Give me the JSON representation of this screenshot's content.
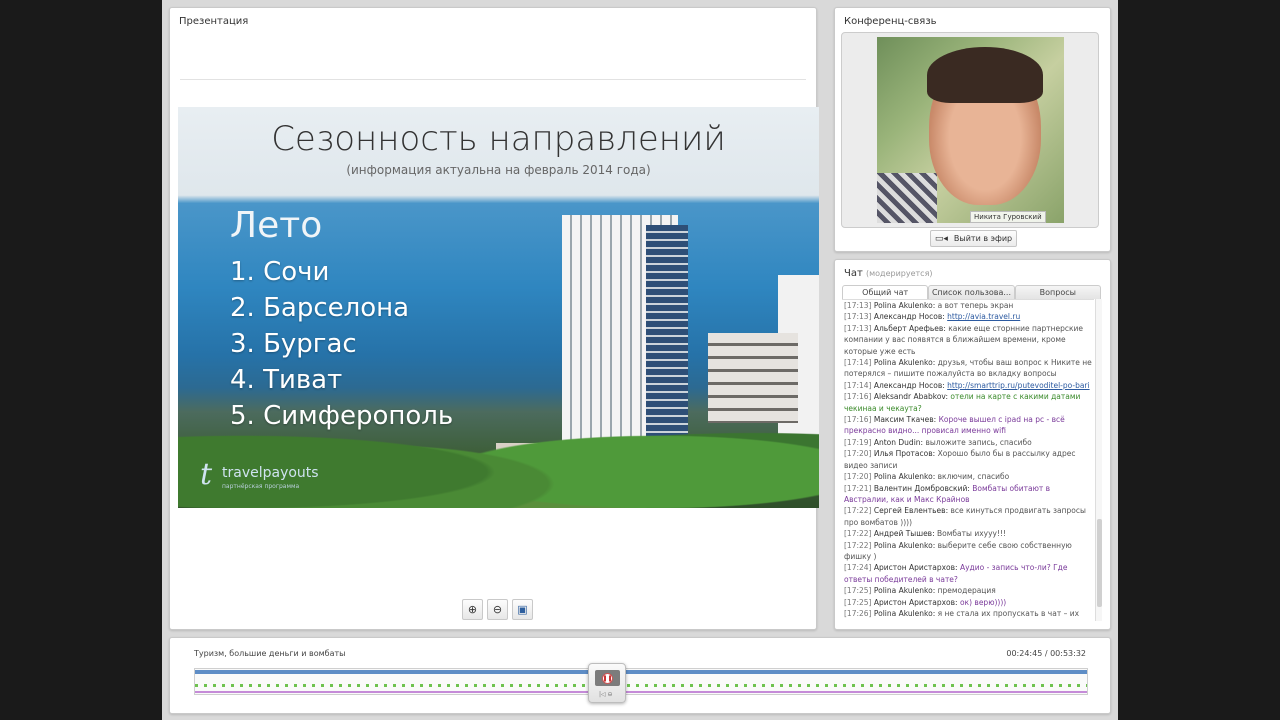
{
  "presentation": {
    "title": "Презентация",
    "slide": {
      "title": "Сезонность направлений",
      "subtitle": "(информация актуальна на февраль 2014 года)",
      "season": "Лето",
      "destinations": [
        "1. Сочи",
        "2. Барселона",
        "3. Бургас",
        "4. Тиват",
        "5. Симферополь"
      ],
      "logo_text": "travelpayouts",
      "logo_tagline": "партнёрская программа"
    },
    "toolbar": {
      "zoom_in_icon": "zoom-in-icon",
      "zoom_out_icon": "zoom-out-icon",
      "save_icon": "save-icon"
    }
  },
  "conference": {
    "title": "Конференц-связь",
    "speaker_name": "Никита Гуровский",
    "leave_button": "Выйти в эфир"
  },
  "chat": {
    "title": "Чат",
    "moderated": "(модерируется)",
    "tabs": [
      "Общий чат",
      "Список пользова...",
      "Вопросы"
    ],
    "messages": [
      {
        "time": "[17:13]",
        "author": "Polina Akulenko:",
        "text": "а вот теперь экран",
        "color": "gray"
      },
      {
        "time": "[17:13]",
        "author": "Александр Носов:",
        "text": "http://avia.travel.ru",
        "color": "link"
      },
      {
        "time": "[17:13]",
        "author": "Альберт Арефьев:",
        "text": "какие еще сторнние партнерские компании у вас появятся в ближайшем времени, кроме которые уже есть",
        "color": "gray"
      },
      {
        "time": "[17:14]",
        "author": "Polina Akulenko:",
        "text": "друзья, чтобы ваш вопрос к Никите не потерялся – пишите пожалуйста во вкладку вопросы",
        "color": "gray"
      },
      {
        "time": "[17:14]",
        "author": "Александр Носов:",
        "text": "http://smarttrip.ru/putevoditel-po-bari",
        "color": "link"
      },
      {
        "time": "[17:16]",
        "author": "Aleksandr Ababkov:",
        "text": "отели на карте с какими датами чекинаа и чекаута?",
        "color": "green"
      },
      {
        "time": "[17:16]",
        "author": "Максим Ткачев:",
        "text": "Короче вышел с ipad на pc - всё прекрасно видно... провисал именно wifi",
        "color": "purple"
      },
      {
        "time": "[17:19]",
        "author": "Anton Dudin:",
        "text": "выложите запись, спасибо",
        "color": "gray"
      },
      {
        "time": "[17:20]",
        "author": "Илья Протасов:",
        "text": "Хорошо было бы в рассылку адрес видео записи",
        "color": "gray"
      },
      {
        "time": "[17:20]",
        "author": "Polina Akulenko:",
        "text": "включим, спасибо",
        "color": "gray"
      },
      {
        "time": "[17:21]",
        "author": "Валентин Домбровский:",
        "text": "Вомбаты обитают в Австралии, как и Макс Крайнов",
        "color": "purple"
      },
      {
        "time": "[17:22]",
        "author": "Сергей Евлентьев:",
        "text": "все кинуться продвигать запросы про вомбатов ))))",
        "color": "gray"
      },
      {
        "time": "[17:22]",
        "author": "Андрей Тышев:",
        "text": "Вомбаты ихууу!!!",
        "color": "gray"
      },
      {
        "time": "[17:22]",
        "author": "Polina Akulenko:",
        "text": "выберите себе свою собственную фишку )",
        "color": "gray"
      },
      {
        "time": "[17:24]",
        "author": "Аристон Аристархов:",
        "text": "Аудио - запись что-ли? Где ответы победителей в чате?",
        "color": "purple"
      },
      {
        "time": "[17:25]",
        "author": "Polina Akulenko:",
        "text": "премодерация",
        "color": "gray"
      },
      {
        "time": "[17:25]",
        "author": "Аристон Аристархов:",
        "text": "ок) верю))))",
        "color": "purple"
      },
      {
        "time": "[17:26]",
        "author": "Polina Akulenko:",
        "text": "я не стала их пропускать в чат – их тонна )",
        "color": "gray"
      }
    ]
  },
  "player": {
    "title": "Туризм, большие деньги и вомбаты",
    "time": "00:24:45 / 00:53:32",
    "progress": 0.462
  },
  "colors": {
    "accent_blue": "#5e8dc6",
    "chat_green": "#3a8a2a",
    "chat_purple": "#7a3a9a",
    "track_purple": "#c58bd8"
  }
}
